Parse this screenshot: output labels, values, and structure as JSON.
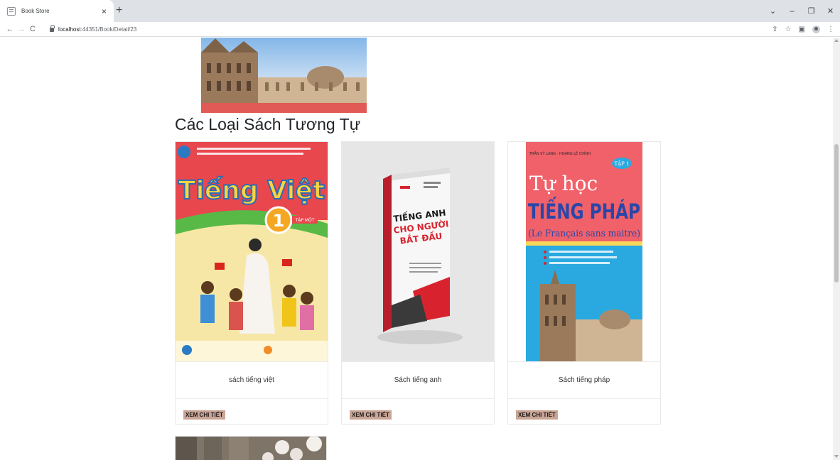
{
  "browser": {
    "tab_title": "Book Store",
    "tab_close": "×",
    "new_tab": "+",
    "url_host": "localhost",
    "url_path": ":44351/Book/Detail/23",
    "win_minimize": "⌄",
    "win_min": "–",
    "win_restore": "❐",
    "win_close": "✕"
  },
  "page": {
    "heading": "Các Loại Sách Tương Tự",
    "books": [
      {
        "name": "sách tiếng việt",
        "button": "XEM CHI TIẾT",
        "cover_title": "Tiếng Việt",
        "cover_number": "1",
        "cover_sub": "TẬP MỘT"
      },
      {
        "name": "Sách tiếng anh",
        "button": "XEM CHI TIẾT",
        "cover_title": "TIẾNG ANH",
        "cover_title2": "CHO NGƯỜI",
        "cover_title3": "BẮT ĐẦU"
      },
      {
        "name": "Sách tiếng pháp",
        "button": "XEM CHI TIẾT",
        "cover_title": "Tự học",
        "cover_title2": "TIẾNG PHÁP",
        "cover_title3": "(Le Français sans maitre)",
        "cover_author": "TRẦN SỸ LANG - HOÀNG LÊ CHÍNH",
        "cover_tap": "TẬP 1"
      }
    ]
  },
  "colors": {
    "button_bg": "#caa596",
    "heading": "#212529"
  },
  "icons": [
    "back-icon",
    "forward-icon",
    "reload-icon",
    "lock-icon",
    "share-icon",
    "star-icon",
    "sidepanel-icon",
    "profile-icon",
    "menu-icon"
  ]
}
